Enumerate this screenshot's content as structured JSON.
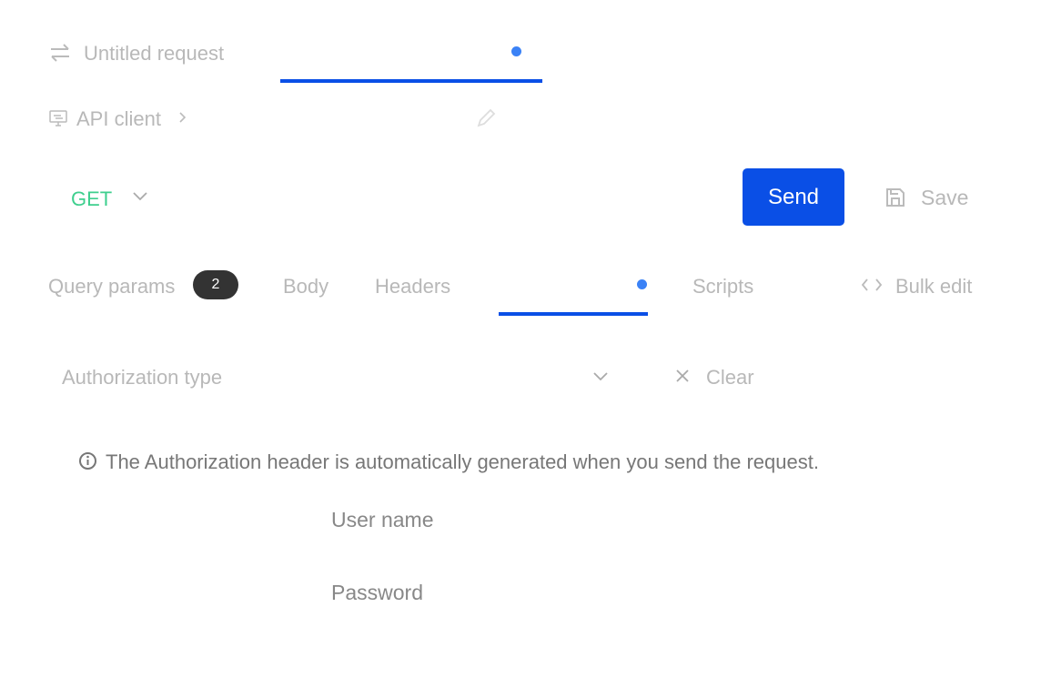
{
  "request": {
    "title": "Untitled request",
    "breadcrumb": "API client"
  },
  "method": "GET",
  "send_label": "Send",
  "save_label": "Save",
  "tabs": [
    {
      "label": "Query params",
      "badge": "2"
    },
    {
      "label": "Body"
    },
    {
      "label": "Headers"
    },
    {
      "label": "",
      "active": true
    },
    {
      "label": "Scripts"
    }
  ],
  "bulk_edit": "Bulk edit",
  "auth": {
    "type_placeholder": "Authorization type",
    "clear": "Clear",
    "info": "The Authorization header is automatically generated when you send the request.",
    "username": "User name",
    "password": "Password"
  },
  "colors": {
    "accent": "#0a4fe6",
    "method": "#3ecf8e",
    "dot": "#3b82f6"
  }
}
